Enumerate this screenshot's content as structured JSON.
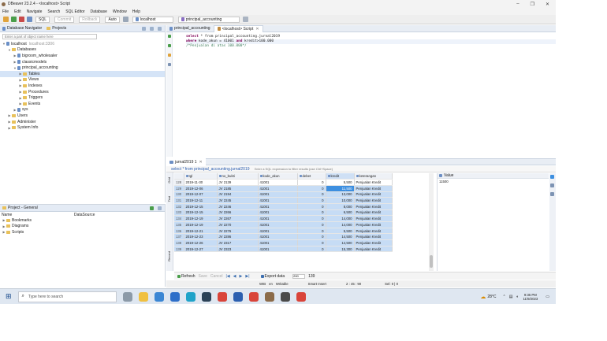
{
  "window": {
    "title": "DBeaver 23.2.4 - <localhost> Script"
  },
  "menu": [
    "File",
    "Edit",
    "Navigate",
    "Search",
    "SQL Editor",
    "Database",
    "Window",
    "Help"
  ],
  "toolbar": {
    "sql_label": "SQL",
    "commit_label": "Commit",
    "rollback_label": "Rollback",
    "auto_label": "Auto",
    "connection": "localhost",
    "schema": "principal_accounting"
  },
  "navigator": {
    "tab_navigator": "Database Navigator",
    "tab_projects": "Projects",
    "filter_placeholder": "Enter a part of object name here",
    "items": [
      {
        "label": "localhost",
        "extra": "localhost:3306"
      },
      {
        "label": "Databases"
      },
      {
        "label": "bigroom_wholesaler"
      },
      {
        "label": "classicmodels"
      },
      {
        "label": "principal_accounting"
      },
      {
        "label": "Tables"
      },
      {
        "label": "Views"
      },
      {
        "label": "Indexes"
      },
      {
        "label": "Procedures"
      },
      {
        "label": "Triggers"
      },
      {
        "label": "Events"
      },
      {
        "label": "sys"
      },
      {
        "label": "Users"
      },
      {
        "label": "Administer"
      },
      {
        "label": "System Info"
      }
    ]
  },
  "project": {
    "title": "Project - General",
    "col_name": "Name",
    "col_datasource": "DataSource",
    "items": [
      "Bookmarks",
      "Diagrams",
      "Scripts"
    ]
  },
  "editor": {
    "tab1": "principal_accounting",
    "tab2": "<localhost> Script",
    "line1_kw": "select",
    "line1_rest": " * from principal_accounting.jurnal2019",
    "line2_kw1": "where",
    "line2_mid": " kode_akun = 41001 ",
    "line2_kw2": "and",
    "line2_rest": " kredit>100.000",
    "line3": "/*Penjualan di atas 100.000*/"
  },
  "results": {
    "tab": "jurnal2019 1",
    "filter_text": "select * from principal_accounting.jurnal2019",
    "filter_hint": "Enter a SQL expression to filter results (use Ctrl+Space)",
    "side_labels": [
      "Grid",
      "Text",
      "Record"
    ],
    "columns": [
      "tgl",
      "no_bukti",
      "kode_akun",
      "debet",
      "kredit",
      "keterangan"
    ],
    "rows": [
      {
        "n": "128",
        "tgl": "2019-11-30",
        "bukti": "JV 2139",
        "akun": "41001",
        "debet": "0",
        "kredit": "5,500",
        "ket": "Penjualan Kredit"
      },
      {
        "n": "129",
        "tgl": "2019-12-06",
        "bukti": "JV 2185",
        "akun": "41001",
        "debet": "0",
        "kredit": "11,500",
        "ket": "Penjualan Kredit"
      },
      {
        "n": "130",
        "tgl": "2019-12-07",
        "bukti": "JV 2194",
        "akun": "41001",
        "debet": "0",
        "kredit": "13,000",
        "ket": "Penjualan Kredit"
      },
      {
        "n": "131",
        "tgl": "2019-12-11",
        "bukti": "JV 2245",
        "akun": "41001",
        "debet": "0",
        "kredit": "10,000",
        "ket": "Penjualan Kredit"
      },
      {
        "n": "132",
        "tgl": "2019-12-15",
        "bukti": "JV 2246",
        "akun": "41001",
        "debet": "0",
        "kredit": "8,000",
        "ket": "Penjualan Kredit"
      },
      {
        "n": "133",
        "tgl": "2019-12-15",
        "bukti": "JV 2266",
        "akun": "41001",
        "debet": "0",
        "kredit": "6,500",
        "ket": "Penjualan Kredit"
      },
      {
        "n": "134",
        "tgl": "2019-12-19",
        "bukti": "JV 2267",
        "akun": "41001",
        "debet": "0",
        "kredit": "14,000",
        "ket": "Penjualan Kredit"
      },
      {
        "n": "135",
        "tgl": "2019-12-19",
        "bukti": "JV 2270",
        "akun": "41001",
        "debet": "0",
        "kredit": "14,000",
        "ket": "Penjualan Kredit"
      },
      {
        "n": "136",
        "tgl": "2019-12-21",
        "bukti": "JV 2276",
        "akun": "41001",
        "debet": "0",
        "kredit": "5,500",
        "ket": "Penjualan Kredit"
      },
      {
        "n": "137",
        "tgl": "2019-12-23",
        "bukti": "JV 2286",
        "akun": "41001",
        "debet": "0",
        "kredit": "14,500",
        "ket": "Penjualan Kredit"
      },
      {
        "n": "138",
        "tgl": "2019-12-26",
        "bukti": "JV 2317",
        "akun": "41001",
        "debet": "0",
        "kredit": "14,500",
        "ket": "Penjualan Kredit"
      },
      {
        "n": "139",
        "tgl": "2019-12-27",
        "bukti": "JV 2323",
        "akun": "41001",
        "debet": "0",
        "kredit": "15,300",
        "ket": "Penjualan Kredit"
      }
    ],
    "value_panel": {
      "title": "Value",
      "value": "11500"
    },
    "bottom": {
      "refresh": "Refresh",
      "save": "Save",
      "cancel": "Cancel",
      "export": "Export data",
      "limit": "200",
      "count": "139"
    }
  },
  "statusbar": {
    "encoding": "WIB",
    "locale": "en",
    "mode": "Writable",
    "insert": "Smart Insert",
    "position": "2 : 45 : 90",
    "sel": "Sel: 0 | 0"
  },
  "taskbar": {
    "search_placeholder": "Type here to search",
    "temp": "28°C",
    "time": "9:35 PM",
    "date": "11/9/2023"
  }
}
